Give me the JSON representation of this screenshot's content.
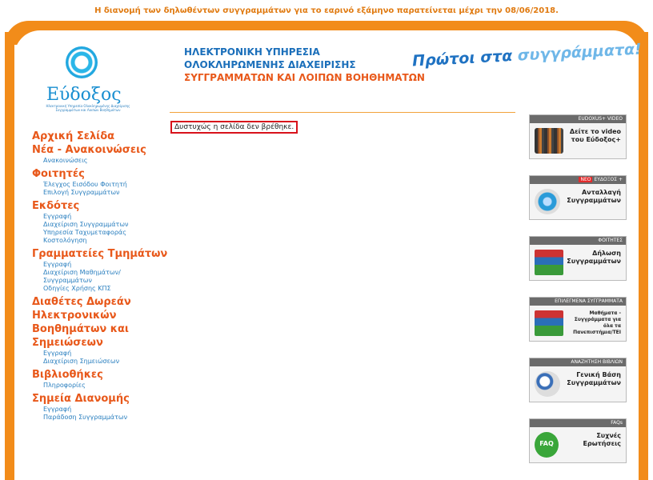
{
  "notice": "Η διανομή των δηλωθέντων συγγραμμάτων για το εαρινό εξάμηνο παρατείνεται μέχρι την 08/06/2018.",
  "logo": {
    "name": "Εύδοξος",
    "subtitle": "Ηλεκτρονική Υπηρεσία Ολοκληρωμένης Διαχείρισης Συγγραμμάτων και Λοιπών Βοηθημάτων"
  },
  "header": {
    "line1": "ΗΛΕΚΤΡΟΝΙΚΗ ΥΠΗΡΕΣΙΑ",
    "line2": "ΟΛΟΚΛΗΡΩΜΕΝΗΣ ΔΙΑΧΕΙΡΙΣΗΣ",
    "line3": "ΣΥΓΓΡΑΜΜΑΤΩΝ ΚΑΙ ΛΟΙΠΩΝ ΒΟΗΘΗΜΑΤΩΝ",
    "slogan_a": "Πρώτοι στα ",
    "slogan_b": "συγγράμματα!"
  },
  "message": "Δυστυχώς η σελίδα δεν βρέθηκε.",
  "sidebar": {
    "home": "Αρχική Σελίδα",
    "news": "Νέα - Ανακοινώσεις",
    "news_items": [
      "Ανακοινώσεις"
    ],
    "students": "Φοιτητές",
    "students_items": [
      "Έλεγχος Εισόδου Φοιτητή",
      "Επιλογή Συγγραμμάτων"
    ],
    "publishers": "Εκδότες",
    "publishers_items": [
      "Εγγραφή",
      "Διαχείριση Συγγραμμάτων",
      "Υπηρεσία Ταχυμεταφοράς",
      "Κοστολόγηση"
    ],
    "secretariats": "Γραμματείες Τμημάτων",
    "secretariats_items": [
      "Εγγραφή",
      "Διαχείριση Μαθημάτων/ Συγγραμμάτων",
      "Οδηγίες Χρήσης ΚΠΣ"
    ],
    "free": "Διαθέτες Δωρεάν Ηλεκτρονικών Βοηθημάτων και Σημειώσεων",
    "free_items": [
      "Εγγραφή",
      "Διαχείριση Σημειώσεων"
    ],
    "libraries": "Βιβλιοθήκες",
    "libraries_items": [
      "Πληροφορίες"
    ],
    "points": "Σημεία Διανομής",
    "points_items": [
      "Εγγραφή",
      "Παράδοση Συγγραμμάτων"
    ]
  },
  "widgets": [
    {
      "caption": "EUDOXUS+ VIDEO",
      "text": "Δείτε το video του Εύδοξος+",
      "icon": "video-icon"
    },
    {
      "caption_neo": "NEO",
      "caption": "ΕΥΔΟΞΟΣ +",
      "text": "Ανταλλαγή Συγγραμμάτων",
      "icon": "disk-icon"
    },
    {
      "caption": "ΦΟΙΤΗΤΕΣ",
      "text": "Δήλωση Συγγραμμάτων",
      "icon": "books-icon"
    },
    {
      "caption": "ΕΠΙΛΕΓΜΕΝΑ ΣΥΓΓΡΑΜΜΑΤΑ",
      "text": "Μαθήματα - Συγγράμματα για όλα τα Πανεπιστήμια/ΤΕΙ",
      "icon": "books-icon"
    },
    {
      "caption": "ΑΝΑΖΗΤΗΣΗ ΒΙΒΛΙΩΝ",
      "text": "Γενική Βάση Συγγραμμάτων",
      "icon": "search-icon"
    },
    {
      "caption": "FAQs",
      "text": "Συχνές Ερωτήσεις",
      "icon": "faq-icon",
      "icon_text": "FAQ"
    }
  ]
}
